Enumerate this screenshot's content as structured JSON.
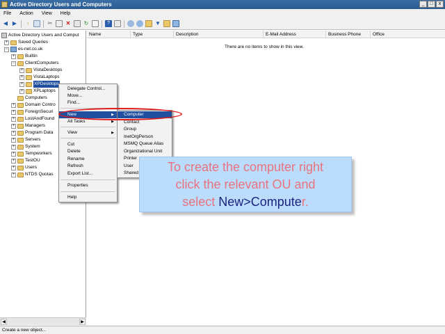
{
  "window": {
    "title": "Active Directory Users and Computers",
    "buttons": [
      "_",
      "□",
      "x"
    ]
  },
  "menubar": [
    "File",
    "Action",
    "View",
    "Help"
  ],
  "toolbar_icons": [
    "back-icon",
    "forward-icon",
    "up-icon",
    "show-hide-tree-icon",
    "cut-icon",
    "copy-icon",
    "delete-icon",
    "properties-icon",
    "refresh-icon",
    "export-list-icon",
    "help-icon",
    "console-icon",
    "new-user-icon",
    "new-group-icon",
    "new-ou-icon",
    "filter-icon",
    "find-icon",
    "add-to-group-icon"
  ],
  "tree": {
    "root": "Active Directory Users and Comput",
    "saved_queries": "Saved Queries",
    "domain": "es-net.co.uk",
    "builtin": "Builtin",
    "client_computers": "ClientComputers",
    "vista_desktops": "VistaDesktops",
    "vista_laptops": "VistaLaptops",
    "xp_desktops": "XPDesktops",
    "xp_laptops": "XPLaptops",
    "computers": "Computers",
    "domain_controllers": "Domain Contro",
    "foreign_security": "ForeignSecuri",
    "lost_and_found": "LostAndFound",
    "managers": "Managers",
    "program_data": "Program Data",
    "servers": "Servers",
    "system": "System",
    "temp_workers": "Tempworkers",
    "test_ou": "TestOU",
    "users": "Users",
    "ntds_quotas": "NTDS Quotas"
  },
  "list": {
    "columns": [
      "Name",
      "Type",
      "Description",
      "E-Mail Address",
      "Business Phone",
      "Office"
    ],
    "empty_message": "There are no items to show in this view."
  },
  "context_menu": {
    "items": [
      "Delegate Control...",
      "Move...",
      "Find...",
      "New",
      "All Tasks",
      "View",
      "Cut",
      "Delete",
      "Rename",
      "Refresh",
      "Export List...",
      "Properties",
      "Help"
    ]
  },
  "submenu_new": {
    "items": [
      "Computer",
      "Contact",
      "Group",
      "InetOrgPerson",
      "MSMQ Queue Alias",
      "Organizational Unit",
      "Printer",
      "User",
      "Shared"
    ]
  },
  "callout": {
    "line1": "To create the computer right",
    "line2": "click the relevant OU and",
    "line3_pre": "select ",
    "line3_hl": "New>Compute",
    "line3_post": "r."
  },
  "status_text": "Create a new object...",
  "colors": {
    "selection": "#1f4f9e",
    "callout_bg": "#bcdcfc",
    "callout_text": "#e8737f",
    "callout_highlight": "#1a237e",
    "ring": "#e01b1b"
  }
}
